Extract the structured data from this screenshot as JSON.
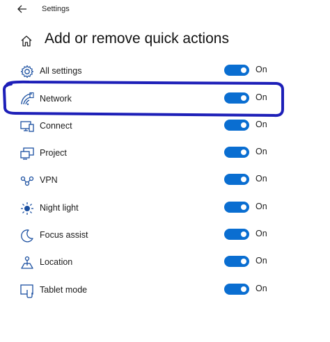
{
  "window": {
    "title": "Settings"
  },
  "header": {
    "title": "Add or remove quick actions"
  },
  "accent_color": "#0a6ed1",
  "annotation_color": "#1d1fb8",
  "quick_actions": [
    {
      "label": "All settings",
      "icon": "gear-icon",
      "state": "On"
    },
    {
      "label": "Network",
      "icon": "network-icon",
      "state": "On"
    },
    {
      "label": "Connect",
      "icon": "connect-icon",
      "state": "On"
    },
    {
      "label": "Project",
      "icon": "project-icon",
      "state": "On"
    },
    {
      "label": "VPN",
      "icon": "vpn-icon",
      "state": "On"
    },
    {
      "label": "Night light",
      "icon": "night-light-icon",
      "state": "On"
    },
    {
      "label": "Focus assist",
      "icon": "moon-icon",
      "state": "On"
    },
    {
      "label": "Location",
      "icon": "location-icon",
      "state": "On"
    },
    {
      "label": "Tablet mode",
      "icon": "tablet-mode-icon",
      "state": "On"
    }
  ]
}
